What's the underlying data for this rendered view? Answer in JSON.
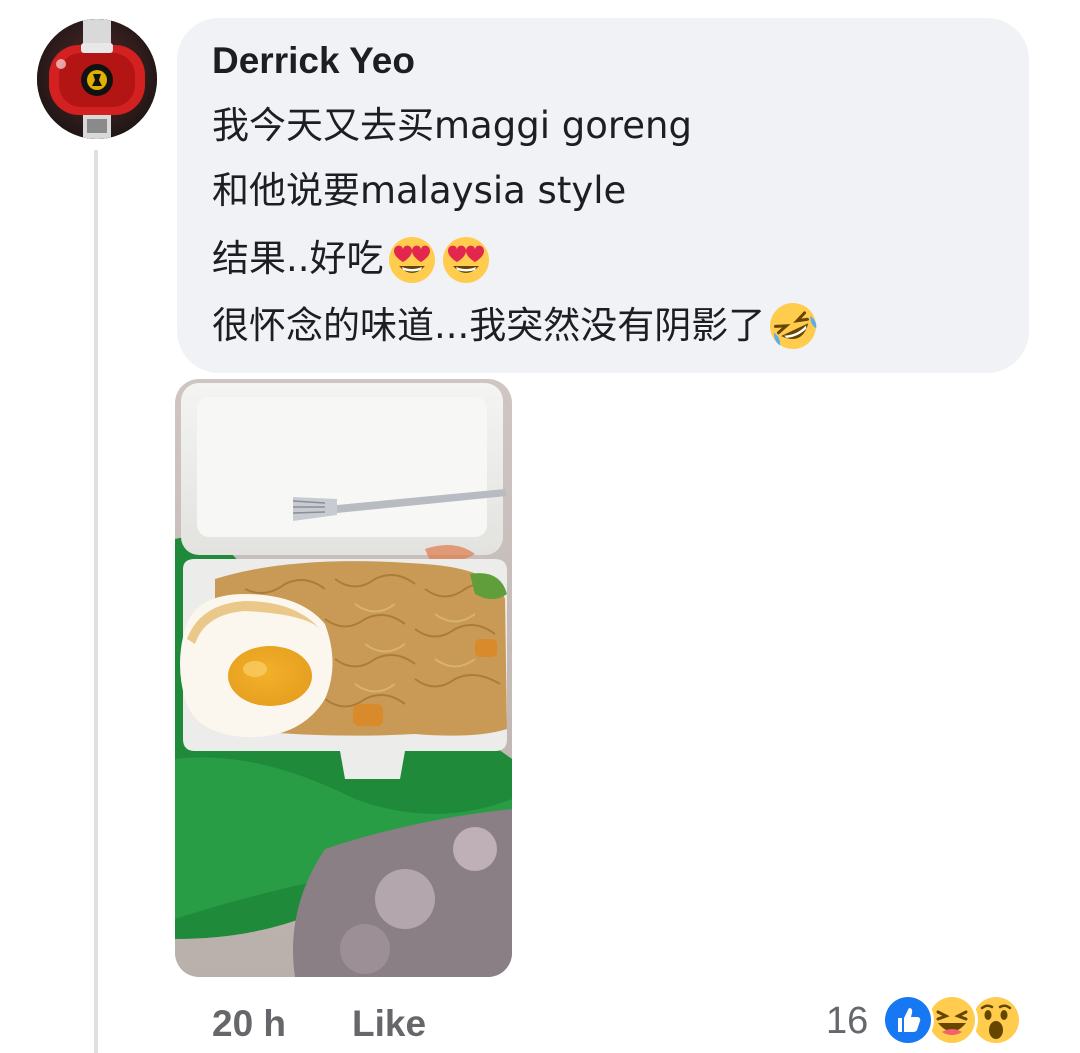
{
  "comment": {
    "author": "Derrick Yeo",
    "lines": [
      "我今天又去买maggi goreng",
      "和他说要malaysia style",
      "结果..好吃",
      "很怀念的味道...我突然没有阴影了"
    ],
    "line3_emojis": [
      "heart-eyes-emoji",
      "heart-eyes-emoji"
    ],
    "line4_emojis": [
      "rolling-laughing-emoji"
    ]
  },
  "footer": {
    "time": "20 h",
    "like_label": "Like",
    "reaction_count": "16",
    "reactions": [
      "like-reaction-icon",
      "haha-reaction-icon",
      "wow-reaction-icon"
    ]
  },
  "colors": {
    "bubble": "#f0f2f5",
    "secondary_text": "#65676b",
    "like_blue": "#1877f2",
    "emoji_yellow": "#ffcc4d"
  }
}
